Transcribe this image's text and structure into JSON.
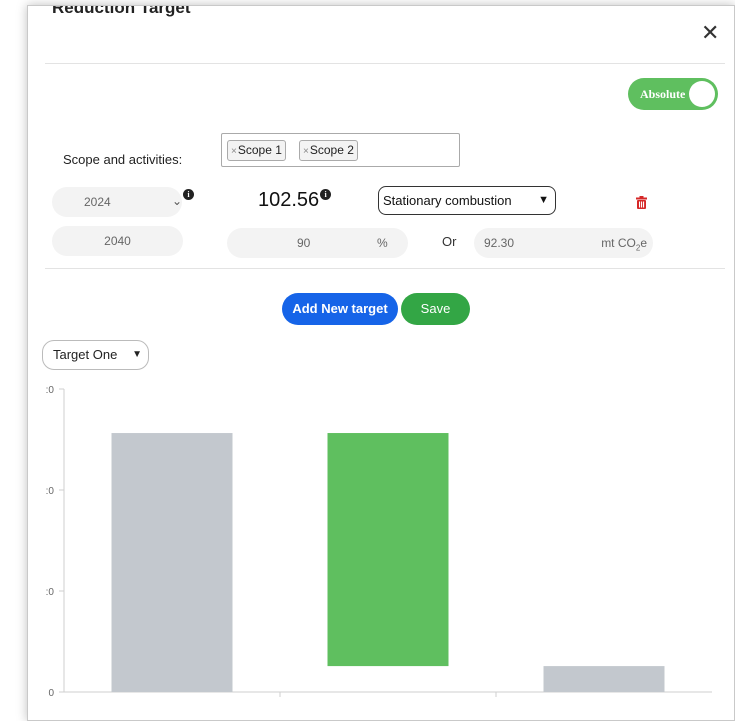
{
  "dialog": {
    "title": "Reduction Target",
    "close_icon": "close-icon"
  },
  "toggle": {
    "label": "Absolute",
    "state": "on"
  },
  "scope": {
    "label": "Scope and activities:",
    "chips": [
      "Scope 1",
      "Scope 2"
    ],
    "remove_glyph": "×"
  },
  "row1": {
    "base_year": "2024",
    "baseline_value": "102.56",
    "activity": "Stationary combustion",
    "info_glyph": "i"
  },
  "row2": {
    "target_year": "2040",
    "percent_value": "90",
    "percent_unit": "%",
    "or_label": "Or",
    "absolute_value": "92.30",
    "absolute_unit_prefix": "mt CO",
    "absolute_unit_sub": "2",
    "absolute_unit_suffix": "e"
  },
  "buttons": {
    "add_label": "Add New target",
    "save_label": "Save"
  },
  "target_select": {
    "selected": "Target One"
  },
  "colors": {
    "green": "#5fbf5f",
    "gray_bar": "#c3c8ce",
    "blue": "#1664e8",
    "save_green": "#33a645",
    "danger": "#d62828"
  },
  "chart_data": {
    "type": "bar",
    "categories": [
      "",
      "",
      ""
    ],
    "values": [
      102.56,
      102.56,
      10.26
    ],
    "bases": [
      0,
      10.26,
      0
    ],
    "colors": [
      "#c3c8ce",
      "#5fbf5f",
      "#c3c8ce"
    ],
    "ylim": [
      0,
      120
    ],
    "yticks": [
      0,
      40,
      80,
      120
    ],
    "ytick_labels": [
      "0",
      ":0",
      ":0",
      ":0"
    ]
  }
}
